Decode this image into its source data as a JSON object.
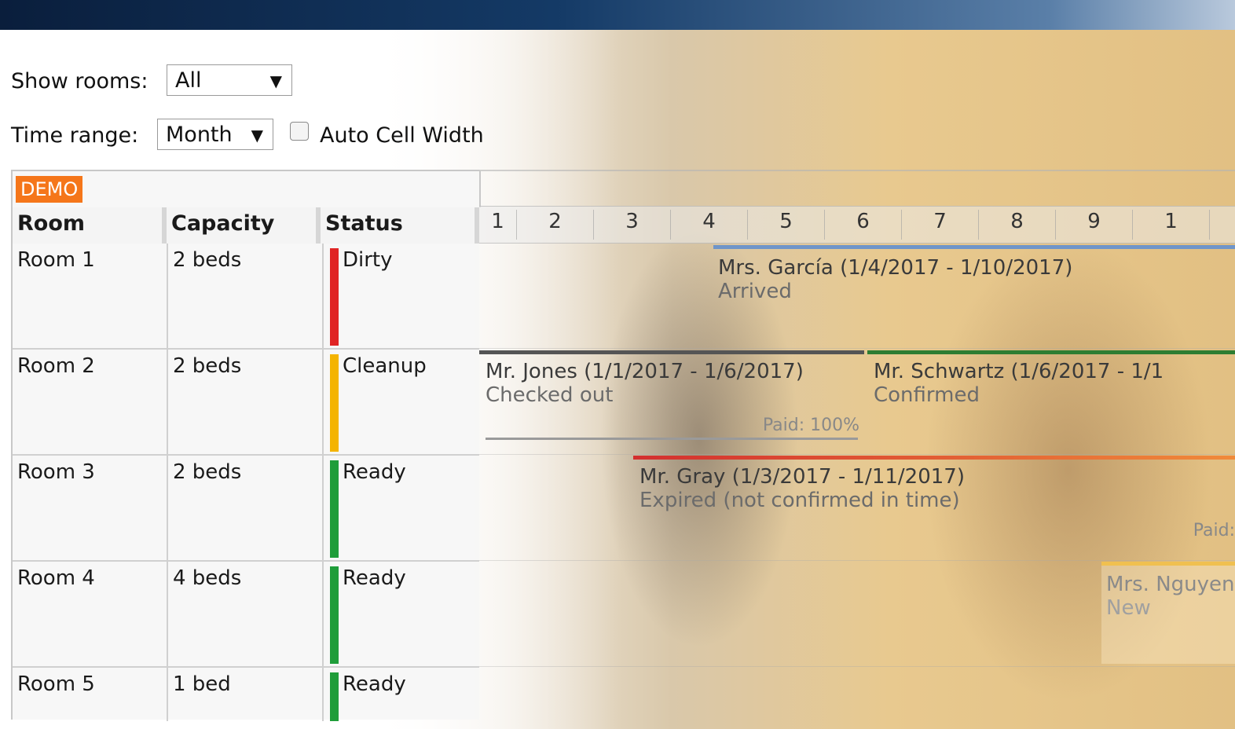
{
  "controls": {
    "show_rooms_label": "Show rooms:",
    "show_rooms_value": "All",
    "time_range_label": "Time range:",
    "time_range_value": "Month",
    "auto_cell_width_label": "Auto Cell Width",
    "dropdown_arrow": "▼"
  },
  "grid": {
    "demo_badge": "DEMO",
    "headers": {
      "room": "Room",
      "capacity": "Capacity",
      "status": "Status"
    },
    "rows": [
      {
        "room": "Room 1",
        "capacity": "2 beds",
        "status": "Dirty"
      },
      {
        "room": "Room 2",
        "capacity": "2 beds",
        "status": "Cleanup"
      },
      {
        "room": "Room 3",
        "capacity": "2 beds",
        "status": "Ready"
      },
      {
        "room": "Room 4",
        "capacity": "4 beds",
        "status": "Ready"
      },
      {
        "room": "Room 5",
        "capacity": "1 bed",
        "status": "Ready"
      }
    ],
    "status_colors": {
      "Dirty": "#e02424",
      "Cleanup": "#f4b400",
      "Ready": "#1f9d3a"
    }
  },
  "timeline": {
    "days": [
      "1",
      "2",
      "3",
      "4",
      "5",
      "6",
      "7",
      "8",
      "9",
      "1"
    ],
    "events": [
      {
        "title": "Mrs. García (1/4/2017 - 1/10/2017)",
        "sub": "Arrived",
        "paid": ""
      },
      {
        "title": "Mr. Jones (1/1/2017 - 1/6/2017)",
        "sub": "Checked out",
        "paid": "Paid: 100%"
      },
      {
        "title": "Mr. Schwartz (1/6/2017 - 1/1",
        "sub": "Confirmed",
        "paid": ""
      },
      {
        "title": "Mr. Gray (1/3/2017 - 1/11/2017)",
        "sub": "Expired (not confirmed in time)",
        "paid": "Paid:"
      },
      {
        "title": "Mrs. Nguyen",
        "sub": "New",
        "paid": ""
      }
    ],
    "colors": {
      "arrived": "#6f95c9",
      "checked_out": "#555555",
      "confirmed": "#2e7d32",
      "expired_start": "#d32f2f",
      "expired_end": "#f08a3a",
      "new": "#f0c050"
    }
  }
}
